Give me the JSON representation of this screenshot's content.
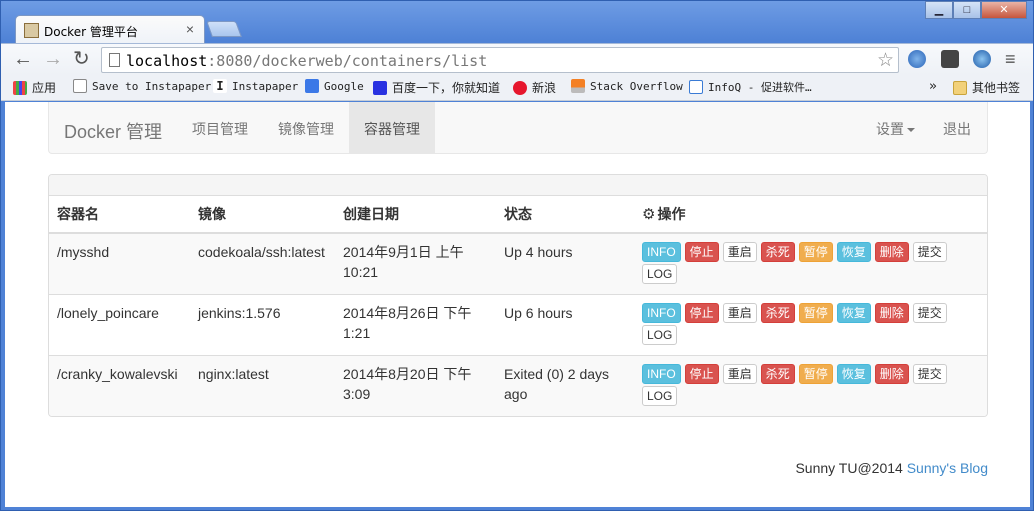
{
  "browser": {
    "tab_title": "Docker 管理平台",
    "tab_close": "×",
    "window_buttons": {
      "minimize": "▁",
      "maximize": "□",
      "close": "✕"
    },
    "url_host": "localhost",
    "url_rest": ":8080/dockerweb/containers/list",
    "star": "☆",
    "menu": "≡",
    "bookmarks": [
      {
        "label": "应用",
        "icon": "apps-icon"
      },
      {
        "label": "Save to Instapaper",
        "icon": "page-icon"
      },
      {
        "label": "Instapaper",
        "icon": "instapaper-icon"
      },
      {
        "label": "Google",
        "icon": "google-icon"
      },
      {
        "label": "百度一下，你就知道",
        "icon": "baidu-icon"
      },
      {
        "label": "新浪",
        "icon": "sina-icon"
      },
      {
        "label": "Stack Overflow",
        "icon": "stackoverflow-icon"
      },
      {
        "label": "InfoQ - 促进软件…",
        "icon": "infoq-icon"
      }
    ],
    "more": "»",
    "other_bookmarks": "其他书签"
  },
  "navbar": {
    "brand": "Docker 管理",
    "links": [
      "项目管理",
      "镜像管理",
      "容器管理"
    ],
    "active": "容器管理",
    "settings": "设置",
    "logout": "退出"
  },
  "table": {
    "headers": [
      "容器名",
      "镜像",
      "创建日期",
      "状态",
      "操作"
    ],
    "action_icon": "gear-icon",
    "rows": [
      {
        "name": "/mysshd",
        "image": "codekoala/ssh:latest",
        "date_line1": "2014年9月1日 上午",
        "date_line2": "10:21",
        "status": "Up 4 hours"
      },
      {
        "name": "/lonely_poincare",
        "image": "jenkins:1.576",
        "date_line1": "2014年8月26日 下午",
        "date_line2": "1:21",
        "status": "Up 6 hours"
      },
      {
        "name": "/cranky_kowalevski",
        "image": "nginx:latest",
        "date_line1": "2014年8月20日 下午",
        "date_line2": "3:09",
        "status": "Exited (0) 2 days ago"
      }
    ],
    "buttons": {
      "info": "INFO",
      "stop": "停止",
      "restart": "重启",
      "kill": "杀死",
      "pause": "暂停",
      "resume": "恢复",
      "delete": "删除",
      "commit": "提交",
      "log": "LOG"
    }
  },
  "footer": {
    "text": "Sunny TU@2014 ",
    "link": "Sunny's Blog"
  }
}
